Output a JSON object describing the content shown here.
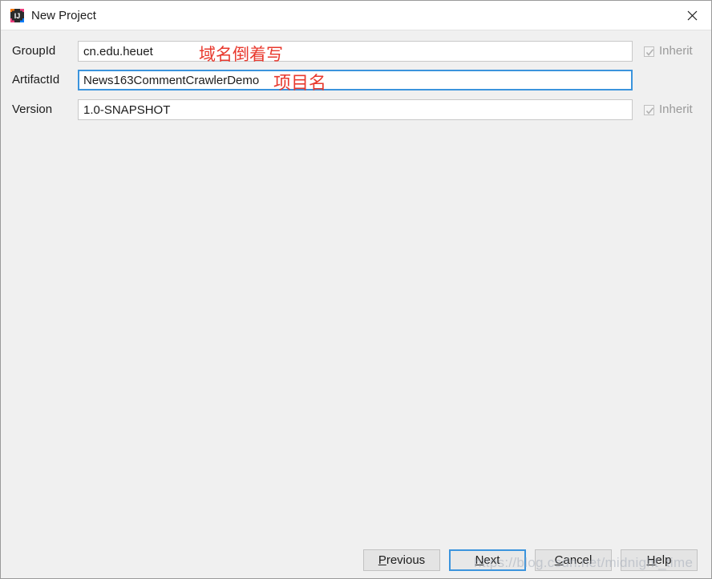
{
  "window": {
    "title": "New Project",
    "app_icon": "intellij-idea-icon",
    "close_icon": "close-icon"
  },
  "form": {
    "fields": [
      {
        "label": "GroupId",
        "value": "cn.edu.heuet",
        "focused": false,
        "inherit_label": "Inherit",
        "inherit_checked": true,
        "inherit_enabled": false
      },
      {
        "label": "ArtifactId",
        "value": "News163CommentCrawlerDemo",
        "focused": true,
        "inherit_label": "",
        "inherit_checked": false,
        "inherit_enabled": false
      },
      {
        "label": "Version",
        "value": "1.0-SNAPSHOT",
        "focused": false,
        "inherit_label": "Inherit",
        "inherit_checked": true,
        "inherit_enabled": false
      }
    ]
  },
  "annotations": [
    {
      "text": "域名倒着写",
      "color": "#e8392e"
    },
    {
      "text": "项目名",
      "color": "#e8392e"
    }
  ],
  "buttons": {
    "previous": {
      "mnemonic": "P",
      "rest": "revious"
    },
    "next": {
      "mnemonic": "N",
      "rest": "ext"
    },
    "cancel": {
      "mnemonic": "C",
      "rest": "ancel"
    },
    "help": {
      "mnemonic": "H",
      "rest": "elp"
    }
  },
  "watermark": {
    "text": "https://blog.csdn.net/midnight_time"
  },
  "colors": {
    "dialog_background": "#f0f0f0",
    "titlebar_background": "#ffffff",
    "focus_blue": "#3b94dd",
    "annotation_red": "#e8392e",
    "field_border": "#c8c8c8"
  }
}
